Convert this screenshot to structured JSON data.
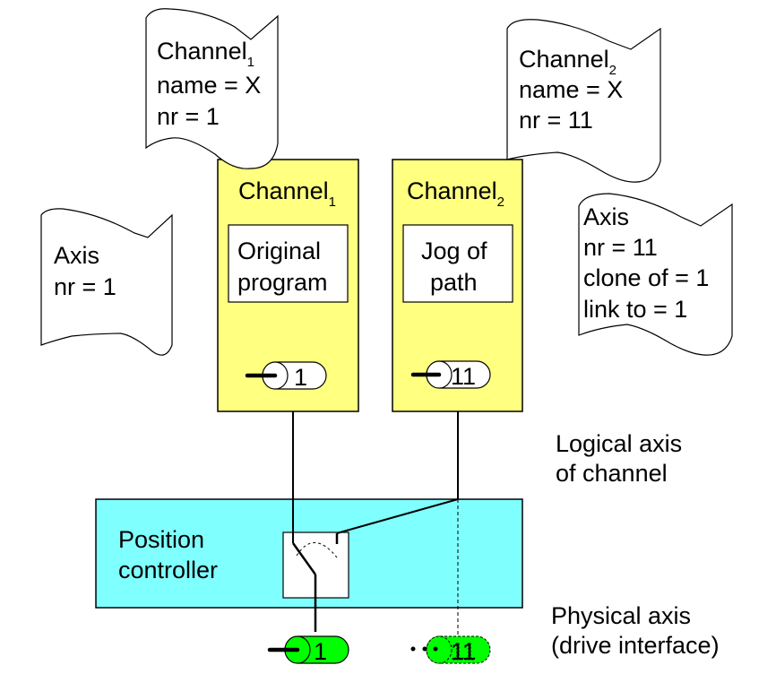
{
  "colors": {
    "channel_fill": "#ffff80",
    "controller_fill": "#80ffff",
    "drive_fill": "#00ff00",
    "program_box_fill": "#ffffff",
    "line": "#000000"
  },
  "doc_channel1": {
    "title": "Channel",
    "subscript": "1",
    "line2": "name = X",
    "line3": "nr = 1"
  },
  "doc_channel2": {
    "title": "Channel",
    "subscript": "2",
    "line2": "name = X",
    "line3": "nr = 11"
  },
  "doc_axis1": {
    "line1": "Axis",
    "line2": "nr = 1"
  },
  "doc_axis11": {
    "line1": "Axis",
    "line2": "nr = 11",
    "line3": "clone of = 1",
    "line4": "link to = 1"
  },
  "channel1": {
    "title": "Channel",
    "subscript": "1",
    "program_line1": "Original",
    "program_line2": "program",
    "logical_axis_label": "1"
  },
  "channel2": {
    "title": "Channel",
    "subscript": "2",
    "program_line1": "Jog of",
    "program_line2": "path",
    "logical_axis_label": "11"
  },
  "controller": {
    "line1": "Position",
    "line2": "controller"
  },
  "labels": {
    "logical_line1": "Logical axis",
    "logical_line2": "of channel",
    "physical_line1": "Physical axis",
    "physical_line2": "(drive interface)"
  },
  "drives": {
    "drive1_label": "1",
    "drive11_label": "11"
  }
}
